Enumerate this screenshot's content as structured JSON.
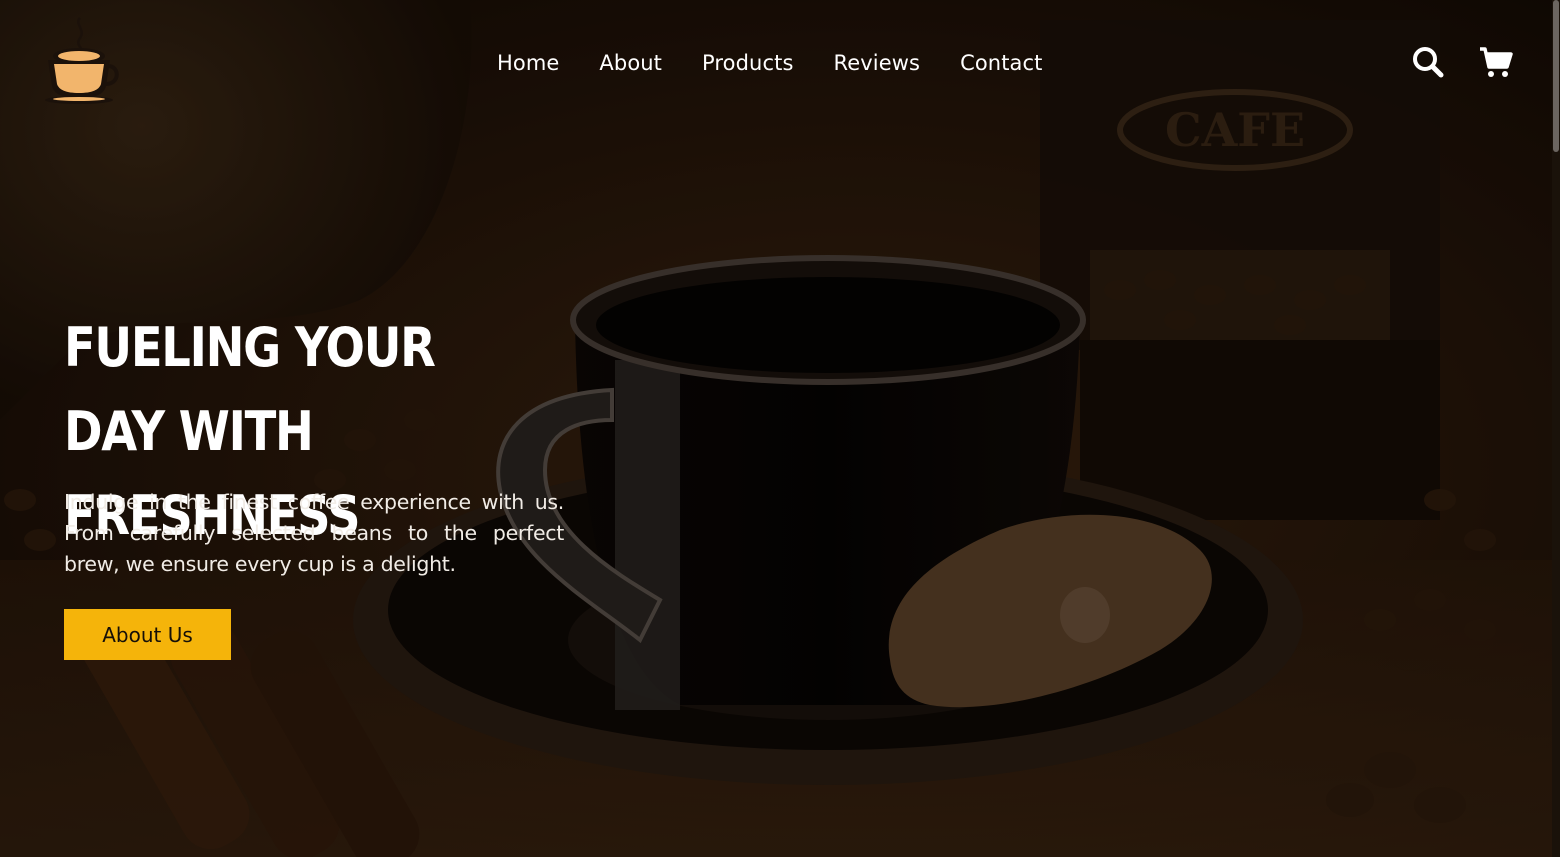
{
  "brand": {
    "logo_icon": "coffee-cup-logo-icon"
  },
  "nav": {
    "items": [
      {
        "label": "Home"
      },
      {
        "label": "About"
      },
      {
        "label": "Products"
      },
      {
        "label": "Reviews"
      },
      {
        "label": "Contact"
      }
    ]
  },
  "header_actions": {
    "search_icon": "search-icon",
    "cart_icon": "shopping-cart-icon"
  },
  "hero": {
    "title": "Fueling Your Day With Freshness",
    "description": "Indulge in the finest coffee experience with us. From carefully selected beans to the perfect brew, we ensure every cup is a delight.",
    "button_label": "About Us"
  },
  "colors": {
    "accent": "#f5b40a",
    "text_light": "#ffffff",
    "background_dark": "#120a04"
  }
}
